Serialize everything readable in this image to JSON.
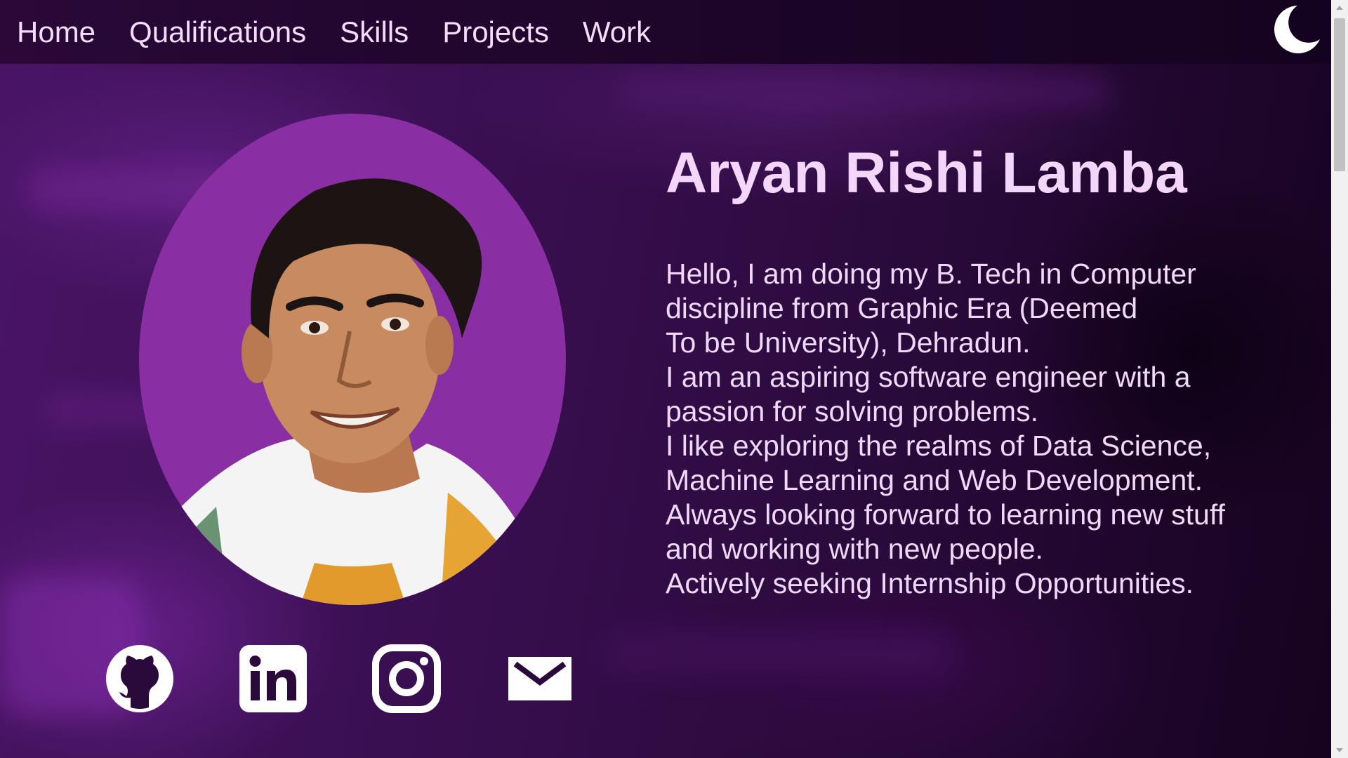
{
  "nav": {
    "items": [
      {
        "label": "Home"
      },
      {
        "label": "Qualifications"
      },
      {
        "label": "Skills"
      },
      {
        "label": "Projects"
      },
      {
        "label": "Work"
      }
    ],
    "theme_toggle_icon": "moon-icon"
  },
  "profile": {
    "name": "Aryan Rishi Lamba",
    "photo_bg_color": "#8a2fa3",
    "bio_lines": [
      "Hello, I am doing my B. Tech in Computer",
      "discipline from Graphic Era (Deemed",
      "To be University), Dehradun.",
      "I am an aspiring software engineer with a",
      "passion for solving problems.",
      "I like exploring the realms of Data Science,",
      "Machine Learning and Web Development.",
      "Always looking forward to learning new stuff",
      "and working with new people.",
      "Actively seeking Internship Opportunities."
    ]
  },
  "social": [
    {
      "icon": "github-icon"
    },
    {
      "icon": "linkedin-icon"
    },
    {
      "icon": "instagram-icon"
    },
    {
      "icon": "mail-icon"
    }
  ],
  "colors": {
    "text": "#f2d8f8",
    "nav_bg": "#1b0526",
    "accent": "#8a2fa3"
  }
}
